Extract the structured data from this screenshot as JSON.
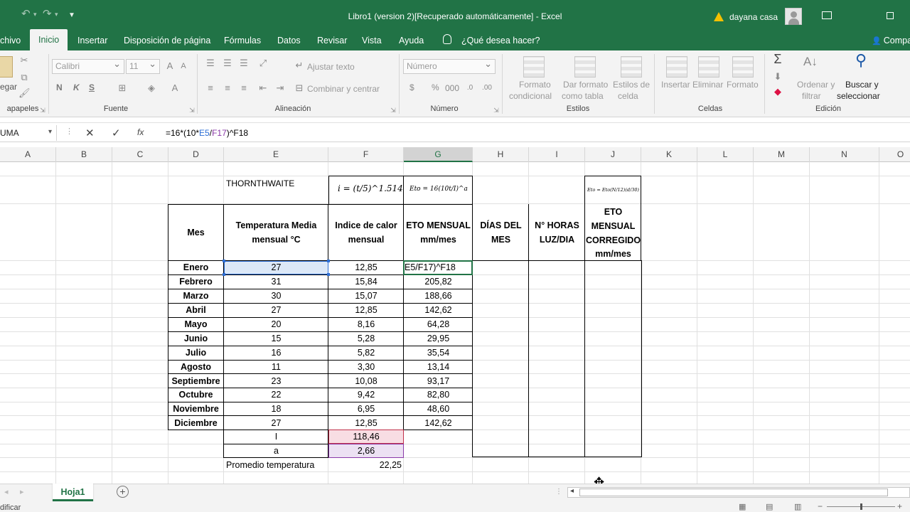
{
  "window": {
    "title": "Libro1 (version 2)[Recuperado automáticamente]  -  Excel",
    "user": "dayana casa"
  },
  "menu": {
    "tabs": [
      "chivo",
      "Inicio",
      "Insertar",
      "Disposición de página",
      "Fórmulas",
      "Datos",
      "Revisar",
      "Vista",
      "Ayuda"
    ],
    "search": "¿Qué desea hacer?",
    "share": "Compa"
  },
  "ribbon": {
    "clipboard": {
      "paste": "egar",
      "label": "apapeles"
    },
    "font": {
      "name": "Calibri",
      "size": "11",
      "bold": "N",
      "italic": "K",
      "underline": "S",
      "label": "Fuente"
    },
    "alignment": {
      "wrap": "Ajustar texto",
      "merge": "Combinar y centrar",
      "label": "Alineación"
    },
    "number": {
      "format": "Número",
      "currency": "$",
      "percent": "%",
      "thousands": "000",
      "label": "Número"
    },
    "styles": {
      "conditional": [
        "Formato",
        "condicional"
      ],
      "table": [
        "Dar formato",
        "como tabla"
      ],
      "cell": [
        "Estilos de",
        "celda"
      ],
      "label": "Estilos"
    },
    "cells": {
      "insert": "Insertar",
      "delete": "Eliminar",
      "format": "Formato",
      "label": "Celdas"
    },
    "editing": {
      "sort": [
        "Ordenar y",
        "filtrar"
      ],
      "find": [
        "Buscar y",
        "seleccionar"
      ],
      "label": "Edición"
    }
  },
  "formula_bar": {
    "name_box": "UMA",
    "formula_prefix": "=16*(10*",
    "formula_ref1": "E5",
    "formula_mid": "/",
    "formula_ref2": "F17",
    "formula_suffix": ")^F18",
    "fx": "fx"
  },
  "columns": [
    "A",
    "B",
    "C",
    "D",
    "E",
    "F",
    "G",
    "H",
    "I",
    "J",
    "K",
    "L",
    "M",
    "N",
    "O"
  ],
  "sheet": {
    "method": "THORNTHWAITE",
    "formula_i": "i = (t/5)^1.514",
    "formula_eto": "Eto = 16(10t/I)^a",
    "formula_corr": "Eto = Eto(N/12)(d/30)",
    "headers": {
      "mes": "Mes",
      "temp": [
        "Temperatura  Media",
        "mensual °C"
      ],
      "indice": [
        "Indice de calor",
        "mensual"
      ],
      "eto": [
        "ETO MENSUAL",
        "mm/mes"
      ],
      "dias": [
        "DÍAS DEL",
        "MES"
      ],
      "horas": [
        "N° HORAS",
        "LUZ/DIA"
      ],
      "corr": [
        "ETO",
        "MENSUAL",
        "CORREGIDO",
        "mm/mes"
      ]
    },
    "rows": [
      {
        "mes": "Enero",
        "temp": "27",
        "indice": "12,85",
        "eto": "E5/F17)^F18"
      },
      {
        "mes": "Febrero",
        "temp": "31",
        "indice": "15,84",
        "eto": "205,82"
      },
      {
        "mes": "Marzo",
        "temp": "30",
        "indice": "15,07",
        "eto": "188,66"
      },
      {
        "mes": "Abril",
        "temp": "27",
        "indice": "12,85",
        "eto": "142,62"
      },
      {
        "mes": "Mayo",
        "temp": "20",
        "indice": "8,16",
        "eto": "64,28"
      },
      {
        "mes": "Junio",
        "temp": "15",
        "indice": "5,28",
        "eto": "29,95"
      },
      {
        "mes": "Julio",
        "temp": "16",
        "indice": "5,82",
        "eto": "35,54"
      },
      {
        "mes": "Agosto",
        "temp": "11",
        "indice": "3,30",
        "eto": "13,14"
      },
      {
        "mes": "Septiembre",
        "temp": "23",
        "indice": "10,08",
        "eto": "93,17"
      },
      {
        "mes": "Octubre",
        "temp": "22",
        "indice": "9,42",
        "eto": "82,80"
      },
      {
        "mes": "Noviembre",
        "temp": "18",
        "indice": "6,95",
        "eto": "48,60"
      },
      {
        "mes": "Diciembre",
        "temp": "27",
        "indice": "12,85",
        "eto": "142,62"
      }
    ],
    "I_label": "I",
    "I_value": "118,46",
    "a_label": "a",
    "a_value": "2,66",
    "avg_label": "Promedio temperatura",
    "avg_value": "22,25"
  },
  "sheet_tabs": [
    "Hoja1"
  ],
  "status": {
    "mode": "dificar"
  },
  "colors": {
    "excel_green": "#217346",
    "ref_blue": "#2e6fd6",
    "ref_purple": "#8a3aa8",
    "ref_red": "#c0304a"
  }
}
